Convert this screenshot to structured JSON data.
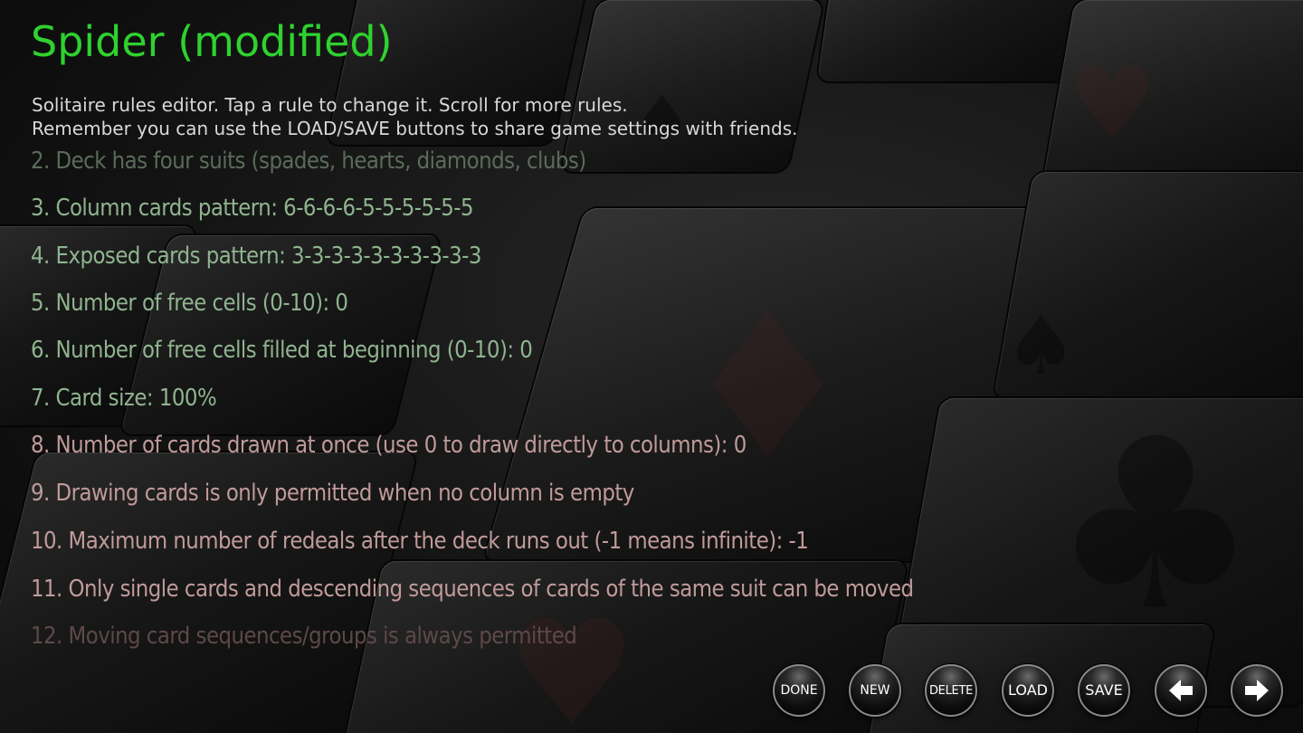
{
  "title": "Spider (modified)",
  "intro": {
    "line1": "Solitaire rules editor. Tap a rule to change it. Scroll for more rules.",
    "line2": "Remember you can use the LOAD/SAVE buttons to share game settings with friends."
  },
  "rules": [
    {
      "text": "2. Deck has four suits (spades, hearts, diamonds, clubs)",
      "color": "#5a6b5a"
    },
    {
      "text": "3. Column cards pattern: 6-6-6-6-5-5-5-5-5-5",
      "color": "#8fb48f"
    },
    {
      "text": "4. Exposed cards pattern: 3-3-3-3-3-3-3-3-3-3",
      "color": "#8fb48f"
    },
    {
      "text": "5. Number of free cells (0-10): 0",
      "color": "#8fb48f"
    },
    {
      "text": "6. Number of free cells filled at beginning (0-10): 0",
      "color": "#8fb48f"
    },
    {
      "text": "7. Card size: 100%",
      "color": "#8fb48f"
    },
    {
      "text": "8. Number of cards drawn at once (use 0 to draw directly to columns): 0",
      "color": "#c09a9a"
    },
    {
      "text": "9. Drawing cards is only permitted when no column is empty",
      "color": "#c09a9a"
    },
    {
      "text": "10. Maximum number of redeals after the deck runs out (-1 means infinite): -1",
      "color": "#c09a9a"
    },
    {
      "text": "11. Only single cards and descending sequences of cards of the same suit can be moved",
      "color": "#c09a9a"
    },
    {
      "text": "12. Moving card sequences/groups is always permitted",
      "color": "#5e4848"
    }
  ],
  "toolbar": {
    "done": "DONE",
    "new": "NEW",
    "delete": "DELETE",
    "load": "LOAD",
    "save": "SAVE",
    "prev_icon": "arrow-left-icon",
    "next_icon": "arrow-right-icon"
  },
  "colors": {
    "title": "#2fd12f",
    "intro": "#d8d8d8",
    "rule_dim": "#5a6b5a",
    "rule_green": "#8fb48f",
    "rule_red": "#c09a9a",
    "rule_faded": "#5e4848"
  }
}
